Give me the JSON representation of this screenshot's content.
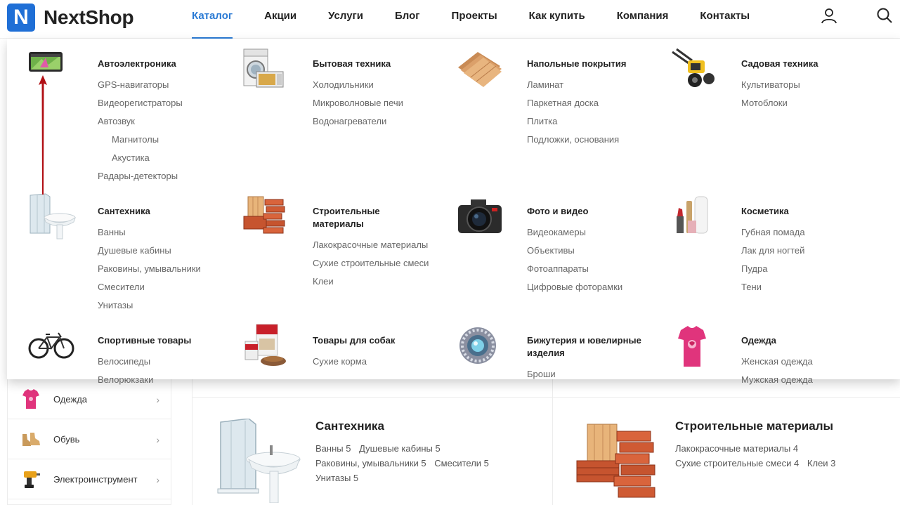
{
  "brand": {
    "logo_letter": "N",
    "name": "NextShop",
    "accent": "#2a7ad4"
  },
  "nav": {
    "items": [
      {
        "label": "Каталог",
        "active": true
      },
      {
        "label": "Акции"
      },
      {
        "label": "Услуги"
      },
      {
        "label": "Блог"
      },
      {
        "label": "Проекты"
      },
      {
        "label": "Как купить"
      },
      {
        "label": "Компания"
      },
      {
        "label": "Контакты"
      }
    ]
  },
  "header_icons": [
    "user-icon",
    "search-icon"
  ],
  "catalog": [
    {
      "title": "Автоэлектроника",
      "icon": "gps-navigator-icon",
      "items": [
        {
          "label": "GPS-навигаторы"
        },
        {
          "label": "Видеорегистраторы"
        },
        {
          "label": "Автозвук"
        },
        {
          "label": "Магнитолы",
          "sub": true
        },
        {
          "label": "Акустика",
          "sub": true
        },
        {
          "label": "Радары-детекторы"
        }
      ]
    },
    {
      "title": "Бытовая техника",
      "icon": "appliances-icon",
      "items": [
        {
          "label": "Холодильники"
        },
        {
          "label": "Микроволновые печи"
        },
        {
          "label": "Водонагреватели"
        }
      ]
    },
    {
      "title": "Напольные покрытия",
      "icon": "flooring-icon",
      "items": [
        {
          "label": "Ламинат"
        },
        {
          "label": "Паркетная доска"
        },
        {
          "label": "Плитка"
        },
        {
          "label": "Подложки, основания"
        }
      ]
    },
    {
      "title": "Садовая техника",
      "icon": "cultivator-icon",
      "items": [
        {
          "label": "Культиваторы"
        },
        {
          "label": "Мотоблоки"
        }
      ]
    },
    {
      "title": "Сантехника",
      "icon": "shower-sink-icon",
      "items": [
        {
          "label": "Ванны"
        },
        {
          "label": "Душевые кабины"
        },
        {
          "label": "Раковины, умывальники"
        },
        {
          "label": "Смесители"
        },
        {
          "label": "Унитазы"
        }
      ]
    },
    {
      "title": "Строительные материалы",
      "icon": "bricks-icon",
      "items": [
        {
          "label": "Лакокрасочные материалы"
        },
        {
          "label": "Сухие строительные смеси"
        },
        {
          "label": "Клеи"
        }
      ]
    },
    {
      "title": "Фото и видео",
      "icon": "camera-icon",
      "items": [
        {
          "label": "Видеокамеры"
        },
        {
          "label": "Объективы"
        },
        {
          "label": "Фотоаппараты"
        },
        {
          "label": "Цифровые фоторамки"
        }
      ]
    },
    {
      "title": "Косметика",
      "icon": "cosmetics-icon",
      "items": [
        {
          "label": "Губная помада"
        },
        {
          "label": "Лак для ногтей"
        },
        {
          "label": "Пудра"
        },
        {
          "label": "Тени"
        }
      ]
    },
    {
      "title": "Спортивные товары",
      "icon": "bicycle-icon",
      "items": [
        {
          "label": "Велосипеды"
        },
        {
          "label": "Велорюкзаки"
        }
      ]
    },
    {
      "title": "Товары для собак",
      "icon": "dog-food-icon",
      "items": [
        {
          "label": "Сухие корма"
        }
      ]
    },
    {
      "title": "Бижутерия и ювелирные изделия",
      "icon": "brooch-icon",
      "items": [
        {
          "label": "Броши"
        }
      ]
    },
    {
      "title": "Одежда",
      "icon": "tshirt-icon",
      "items": [
        {
          "label": "Женская одежда"
        },
        {
          "label": "Мужская одежда"
        }
      ]
    }
  ],
  "sidebar": {
    "items": [
      {
        "label": "Одежда",
        "icon": "tshirt-icon"
      },
      {
        "label": "Обувь",
        "icon": "shoes-icon"
      },
      {
        "label": "Электроинструмент",
        "icon": "drill-icon"
      }
    ]
  },
  "cards": [
    {
      "title": "Сантехника",
      "icon": "shower-sink-icon",
      "links": [
        "Ванны 5",
        "Душевые кабины 5",
        "Раковины, умывальники 5",
        "Смесители 5",
        "Унитазы 5"
      ]
    },
    {
      "title": "Строительные материалы",
      "icon": "bricks-icon",
      "links": [
        "Лакокрасочные материалы 4",
        "Сухие строительные смеси 4",
        "Клеи 3"
      ]
    }
  ]
}
